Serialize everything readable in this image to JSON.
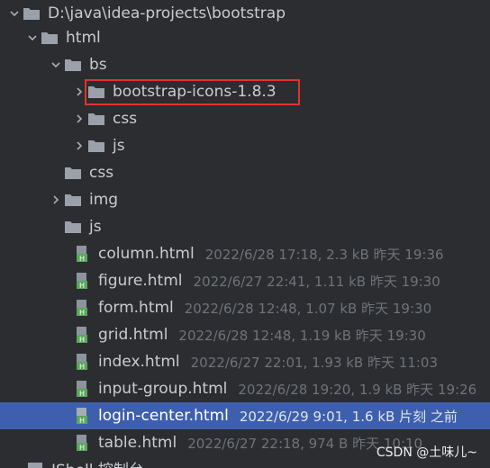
{
  "tree": {
    "root": {
      "label": "D:\\java\\idea-projects\\bootstrap"
    },
    "html_folder": {
      "label": "html"
    },
    "bs_folder": {
      "label": "bs"
    },
    "bootstrap_icons_folder": {
      "label": "bootstrap-icons-1.8.3"
    },
    "bs_css_folder": {
      "label": "css"
    },
    "bs_js_folder": {
      "label": "js"
    },
    "css_folder": {
      "label": "css"
    },
    "img_folder": {
      "label": "img"
    },
    "js_folder": {
      "label": "js"
    },
    "files": [
      {
        "name": "column.html",
        "meta": "2022/6/28 17:18, 2.3 kB 昨天 19:36"
      },
      {
        "name": "figure.html",
        "meta": "2022/6/27 22:41, 1.11 kB 昨天 19:30"
      },
      {
        "name": "form.html",
        "meta": "2022/6/28 12:48, 1.07 kB 昨天 19:30"
      },
      {
        "name": "grid.html",
        "meta": "2022/6/28 12:48, 1.19 kB 昨天 19:30"
      },
      {
        "name": "index.html",
        "meta": "2022/6/27 22:01, 1.93 kB 昨天 11:03"
      },
      {
        "name": "input-group.html",
        "meta": "2022/6/28 19:20, 1.9 kB 昨天 19:26"
      },
      {
        "name": "login-center.html",
        "meta": "2022/6/29 9:01, 1.6 kB 片刻 之前"
      },
      {
        "name": "table.html",
        "meta": "2022/6/27 22:18, 974 B 昨天 10:10"
      }
    ],
    "partial_bottom": {
      "label": "JShell 控制台"
    }
  },
  "watermark": "CSDN @土味儿~",
  "colors": {
    "background": "#2b2d30",
    "selected": "#3d5fae",
    "highlight_border": "#e0342d",
    "folder": "#9aa1ab",
    "html_file_icon": "#5aa85a",
    "meta_text": "#6f737a"
  },
  "icons": {
    "expanded": "chevron-down-icon",
    "collapsed": "chevron-right-icon",
    "folder": "folder-icon",
    "html_file": "html-file-icon"
  }
}
